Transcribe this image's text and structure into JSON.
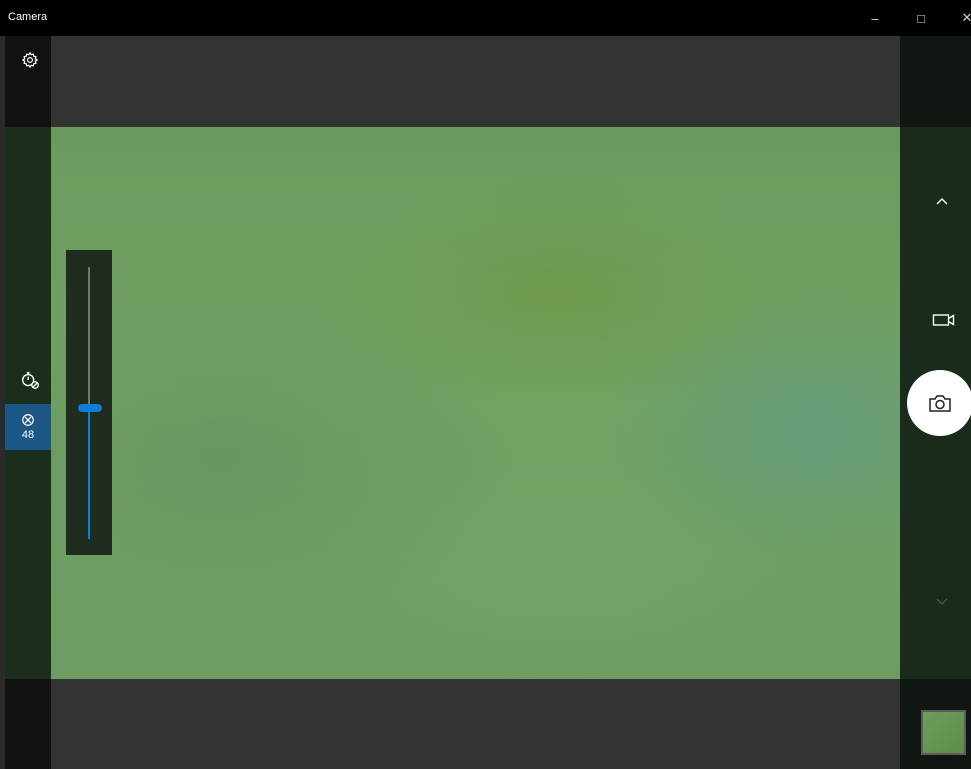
{
  "window": {
    "title": "Camera",
    "controls": {
      "minimize_glyph": "–",
      "maximize_glyph": "□",
      "close_glyph": "✕"
    }
  },
  "left_toolbar": {
    "settings_icon": "gear-icon",
    "timer_icon": "timer-off-icon",
    "brightness": {
      "icon": "brightness-icon",
      "value": "48",
      "active_color": "#1b5684"
    }
  },
  "brightness_slider": {
    "level_fraction": 0.48,
    "accent_color": "#0f7fd8"
  },
  "right_toolbar": {
    "chevron_up_icon": "chevron-up-icon",
    "video_mode_icon": "video-camera-icon",
    "photo_shutter_icon": "camera-icon",
    "chevron_down_icon": "chevron-down-icon"
  },
  "gallery_thumbnail": {
    "icon": "last-photo-thumbnail"
  }
}
